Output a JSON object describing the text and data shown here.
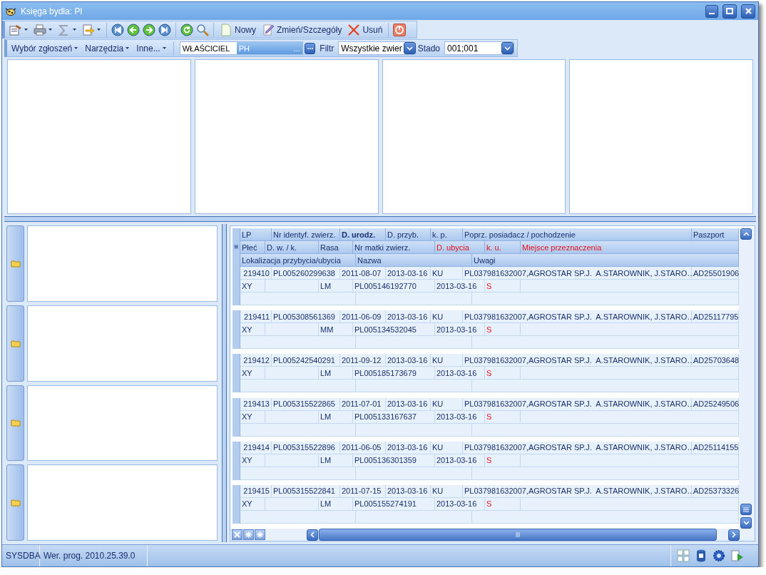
{
  "window": {
    "title": "Księga bydła: Pl"
  },
  "toolbar": {
    "buttons": [
      "Nowy",
      "Zmień/Szczegóły",
      "Usuń"
    ]
  },
  "filter_bar": {
    "menus": [
      "Wybór zgłoszeń",
      "Narzędzia",
      "Inne..."
    ],
    "owner_label": "WŁAŚCICIEL",
    "owner_value": "PH",
    "owner_more": "...",
    "filter_label": "Filtr",
    "filter_value": "Wszystkie zwier",
    "herd_label": "Stado",
    "herd_value": "001;001"
  },
  "grid": {
    "header_rows": [
      [
        {
          "label": "LP",
          "highlight": false,
          "bold": false
        },
        {
          "label": "Nr identyf. zwierz.",
          "highlight": false,
          "bold": false
        },
        {
          "label": "D. urodz.",
          "highlight": false,
          "bold": true
        },
        {
          "label": "D. przyb.",
          "highlight": false,
          "bold": false
        },
        {
          "label": "k. p.",
          "highlight": false,
          "bold": false
        },
        {
          "label": "Poprz. posiadacz / pochodzenie",
          "highlight": false,
          "bold": false
        },
        {
          "label": "Paszport",
          "highlight": false,
          "bold": false
        }
      ],
      [
        {
          "label": "Płeć",
          "highlight": false,
          "bold": false
        },
        {
          "label": "D. w. / k.",
          "highlight": false,
          "bold": false
        },
        {
          "label": "Rasa",
          "highlight": false,
          "bold": false
        },
        {
          "label": "Nr matki zwierz.",
          "highlight": false,
          "bold": false
        },
        {
          "label": "D. ubycia",
          "highlight": true,
          "bold": false
        },
        {
          "label": "k. u.",
          "highlight": true,
          "bold": false
        },
        {
          "label": "Miejsce przeznaczenia",
          "highlight": true,
          "bold": false
        }
      ],
      [
        {
          "label": "Lokalizacja przybycia/ubycia",
          "highlight": false,
          "bold": false
        },
        {
          "label": "Nazwa",
          "highlight": false,
          "bold": false
        },
        {
          "label": "Uwagi",
          "highlight": false,
          "bold": false
        }
      ]
    ],
    "new_row_marker": "⋇",
    "records": [
      {
        "lp": "219410",
        "nr": "PL005260299638",
        "d_urodz": "2011-08-07",
        "d_przyb": "2013-03-16",
        "kp": "KU",
        "poprz": "PL037981632007,AGROSTAR SP.J.  A.STAROWNIK, J.STARO…",
        "paszport": "AD25501906",
        "plec": "XY",
        "rasa": "LM",
        "nr_matki": "PL005146192770",
        "d_ubycia": "2013-03-16",
        "ku": "S"
      },
      {
        "lp": "219411",
        "nr": "PL005308561369",
        "d_urodz": "2011-06-09",
        "d_przyb": "2013-03-16",
        "kp": "KU",
        "poprz": "PL037981632007,AGROSTAR SP.J.  A.STAROWNIK, J.STARO…",
        "paszport": "AD25117795",
        "plec": "XY",
        "rasa": "MM",
        "nr_matki": "PL005134532045",
        "d_ubycia": "2013-03-16",
        "ku": "S"
      },
      {
        "lp": "219412",
        "nr": "PL005242540291",
        "d_urodz": "2011-09-12",
        "d_przyb": "2013-03-16",
        "kp": "KU",
        "poprz": "PL037981632007,AGROSTAR SP.J.  A.STAROWNIK, J.STARO…",
        "paszport": "AD25703648",
        "plec": "XY",
        "rasa": "LM",
        "nr_matki": "PL005185173679",
        "d_ubycia": "2013-03-16",
        "ku": "S"
      },
      {
        "lp": "219413",
        "nr": "PL005315522865",
        "d_urodz": "2011-07-01",
        "d_przyb": "2013-03-16",
        "kp": "KU",
        "poprz": "PL037981632007,AGROSTAR SP.J.  A.STAROWNIK, J.STARO…",
        "paszport": "AD25249506",
        "plec": "XY",
        "rasa": "LM",
        "nr_matki": "PL005133167637",
        "d_ubycia": "2013-03-16",
        "ku": "S"
      },
      {
        "lp": "219414",
        "nr": "PL005315522896",
        "d_urodz": "2011-06-05",
        "d_przyb": "2013-03-16",
        "kp": "KU",
        "poprz": "PL037981632007,AGROSTAR SP.J.  A.STAROWNIK, J.STARO…",
        "paszport": "AD25114155",
        "plec": "XY",
        "rasa": "LM",
        "nr_matki": "PL005136301359",
        "d_ubycia": "2013-03-16",
        "ku": "S"
      },
      {
        "lp": "219415",
        "nr": "PL005315522841",
        "d_urodz": "2011-07-15",
        "d_przyb": "2013-03-16",
        "kp": "KU",
        "poprz": "PL037981632007,AGROSTAR SP.J.  A.STAROWNIK, J.STARO…",
        "paszport": "AD25373326",
        "plec": "XY",
        "rasa": "LM",
        "nr_matki": "PL005155274191",
        "d_ubycia": "2013-03-16",
        "ku": "S"
      }
    ]
  },
  "status_bar": {
    "user": "SYSDBA",
    "version": "Wer. prog. 2010.25.39.0"
  }
}
